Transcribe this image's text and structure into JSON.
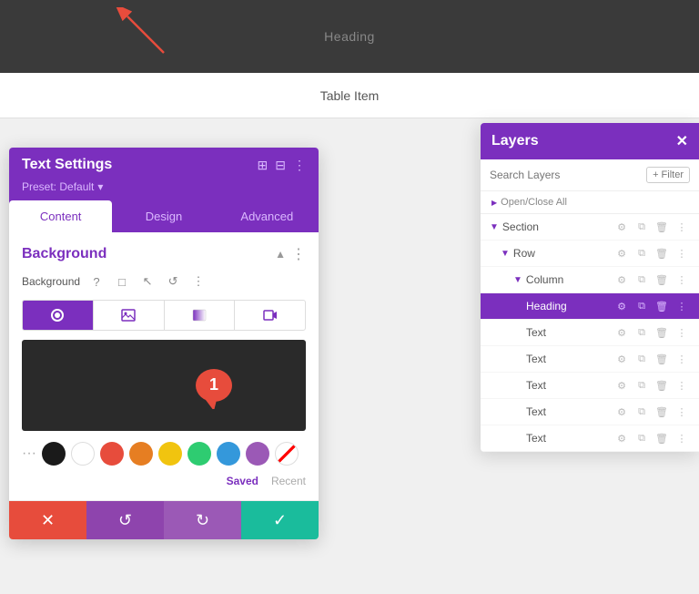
{
  "canvas": {
    "heading_text": "Heading",
    "table_item_text": "Table Item"
  },
  "text_settings_panel": {
    "title": "Text Settings",
    "preset_label": "Preset: Default",
    "preset_arrow": "▾",
    "header_icons": [
      "⊞",
      "⊟",
      "⋮"
    ],
    "tabs": [
      "Content",
      "Design",
      "Advanced"
    ],
    "active_tab": "Content",
    "background_section": {
      "title": "Background",
      "controls": [
        "?",
        "□",
        "↖",
        "↺",
        "⋮"
      ]
    },
    "type_tabs": [
      "color",
      "image",
      "gradient",
      "video"
    ],
    "swatches": [
      {
        "color": "#1a1a1a",
        "label": "black"
      },
      {
        "color": "#ffffff",
        "label": "white"
      },
      {
        "color": "#e74c3c",
        "label": "red"
      },
      {
        "color": "#e67e22",
        "label": "orange"
      },
      {
        "color": "#f1c40f",
        "label": "yellow"
      },
      {
        "color": "#2ecc71",
        "label": "green"
      },
      {
        "color": "#3498db",
        "label": "blue"
      },
      {
        "color": "#9b59b6",
        "label": "purple"
      },
      {
        "color": "striped",
        "label": "none"
      }
    ],
    "saved_label": "Saved",
    "recent_label": "Recent",
    "footer_buttons": {
      "cancel": "✕",
      "undo": "↺",
      "redo": "↻",
      "save": "✓"
    }
  },
  "layers_panel": {
    "title": "Layers",
    "close_icon": "✕",
    "search_placeholder": "Search Layers",
    "filter_label": "+ Filter",
    "open_close_label": "Open/Close All",
    "layers": [
      {
        "name": "Section",
        "indent": 0,
        "chevron": true,
        "active": false
      },
      {
        "name": "Row",
        "indent": 1,
        "chevron": true,
        "active": false
      },
      {
        "name": "Column",
        "indent": 2,
        "chevron": true,
        "active": false
      },
      {
        "name": "Heading",
        "indent": 3,
        "chevron": false,
        "active": true
      },
      {
        "name": "Text",
        "indent": 3,
        "chevron": false,
        "active": false
      },
      {
        "name": "Text",
        "indent": 3,
        "chevron": false,
        "active": false
      },
      {
        "name": "Text",
        "indent": 3,
        "chevron": false,
        "active": false
      },
      {
        "name": "Text",
        "indent": 3,
        "chevron": false,
        "active": false
      },
      {
        "name": "Text",
        "indent": 3,
        "chevron": false,
        "active": false
      }
    ]
  },
  "colors": {
    "purple": "#7b2fbe",
    "red": "#e74c3c",
    "teal": "#1abc9c"
  }
}
